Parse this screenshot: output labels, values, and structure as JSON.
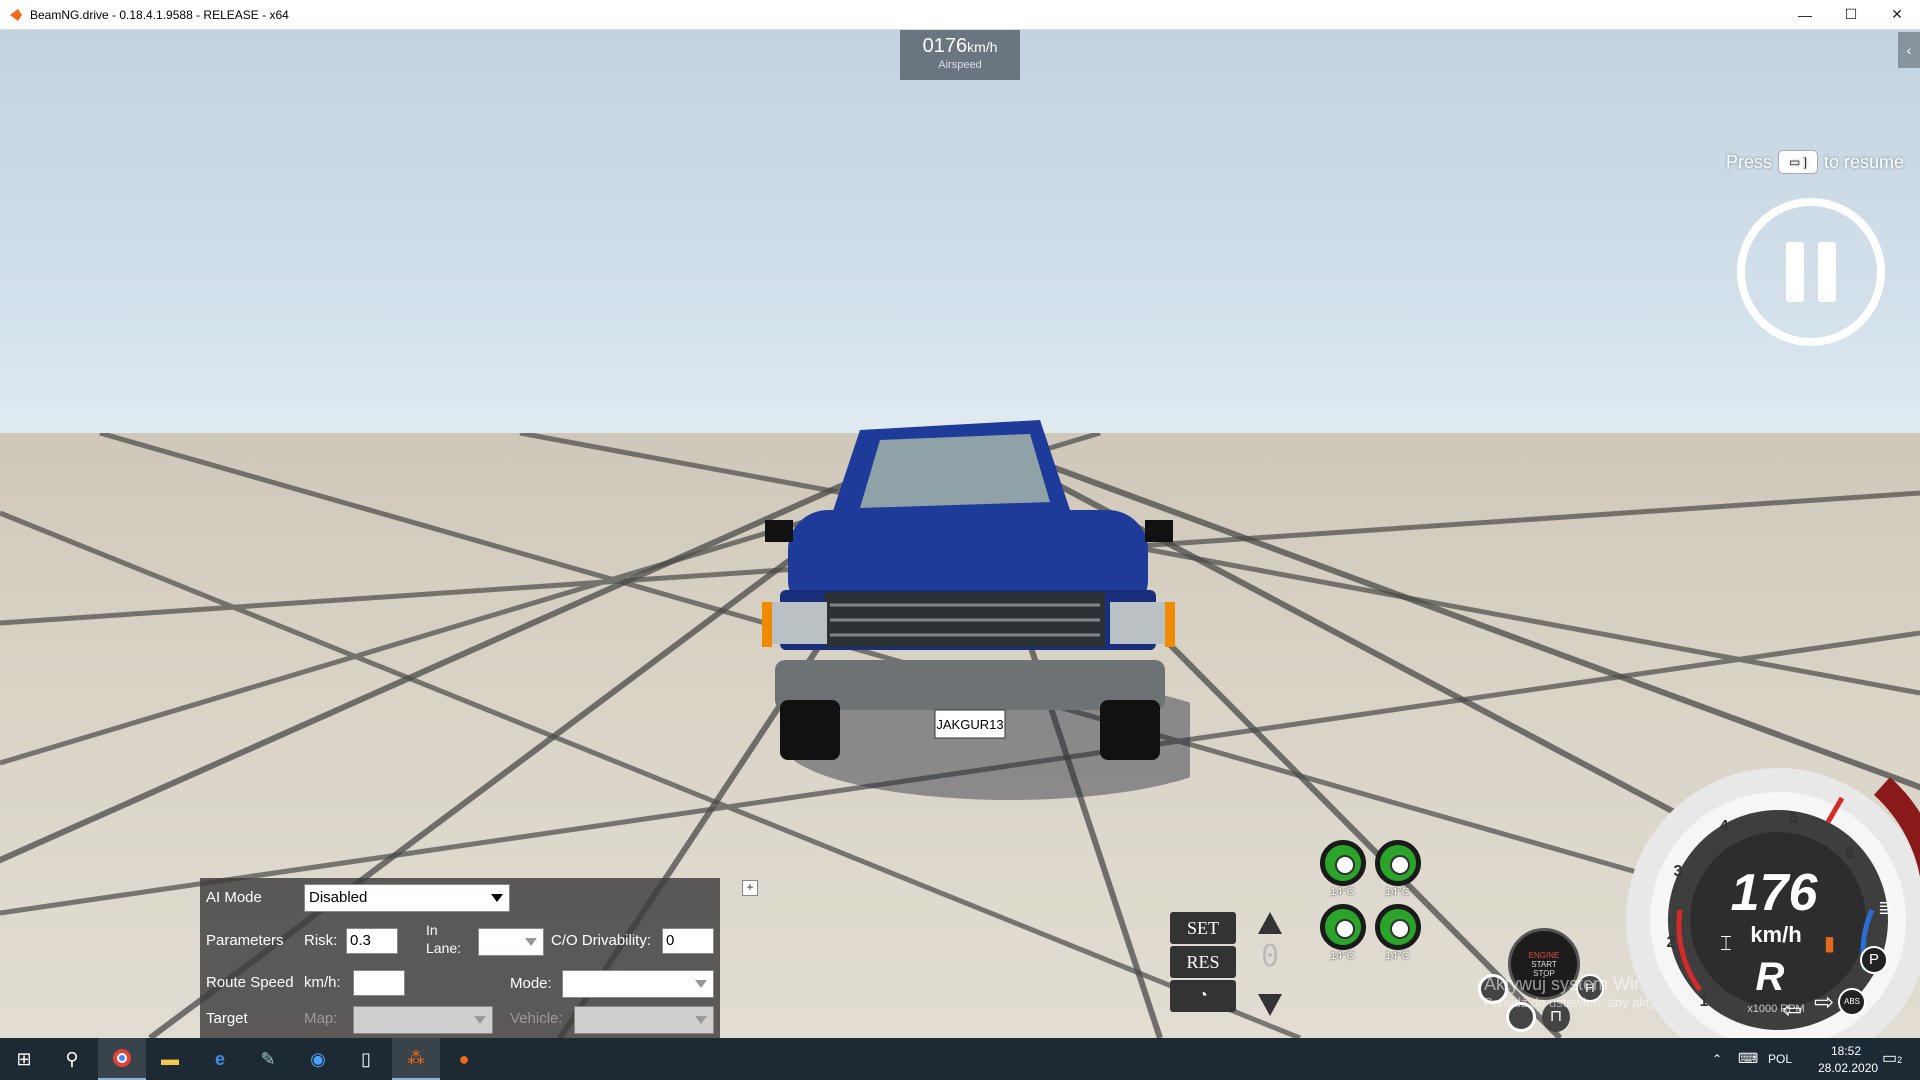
{
  "window": {
    "title": "BeamNG.drive - 0.18.4.1.9588 - RELEASE - x64",
    "minimize": "—",
    "maximize": "☐",
    "close": "✕"
  },
  "airspeed": {
    "value": "0176",
    "unit": "km/h",
    "label": "Airspeed"
  },
  "side_tab": "‹",
  "resume": {
    "press": "Press",
    "key": "▭ ]",
    "suffix": "to resume"
  },
  "car": {
    "plate": "JAKGUR13"
  },
  "ai_panel": {
    "ai_mode_label": "AI Mode",
    "ai_mode_value": "Disabled",
    "parameters_label": "Parameters",
    "risk_label": "Risk:",
    "risk_value": "0.3",
    "in_lane_label_1": "In",
    "in_lane_label_2": "Lane:",
    "drivability_label": "C/O Drivability:",
    "drivability_value": "0",
    "route_speed_label": "Route Speed",
    "kmh_label": "km/h:",
    "route_speed_value": "",
    "mode_label": "Mode:",
    "target_label": "Target",
    "map_label": "Map:",
    "vehicle_label": "Vehicle:",
    "expand": "+"
  },
  "cruise": {
    "set": "SET",
    "res": "RES",
    "speed_digit": "0",
    "gauge_icon": "speedometer-icon"
  },
  "tyres": [
    {
      "temp": "14°C"
    },
    {
      "temp": "14°C"
    },
    {
      "temp": "14°C"
    },
    {
      "temp": "14°C"
    }
  ],
  "engine_button": {
    "line1": "ENGINE",
    "line2": "START",
    "line3": "STOP"
  },
  "dashboard": {
    "speed": "176",
    "speed_unit": "km/h",
    "gear": "R",
    "rpm_label": "x1000 RPM",
    "rpm_ticks": [
      "1",
      "2",
      "3",
      "4",
      "5",
      "6"
    ],
    "park": "P",
    "abs": "ABS"
  },
  "watermark": {
    "line1": "Aktywuj system Windows",
    "line2": "Przejdź do ustawień, aby aktywować system Windows."
  },
  "taskbar": {
    "lang": "POL",
    "time": "18:52",
    "date": "28.02.2020",
    "notif_count": "2"
  },
  "colors": {
    "car_blue": "#1f3b9a",
    "tyre_green": "#2aa52a",
    "accent_red": "#c0202a"
  }
}
